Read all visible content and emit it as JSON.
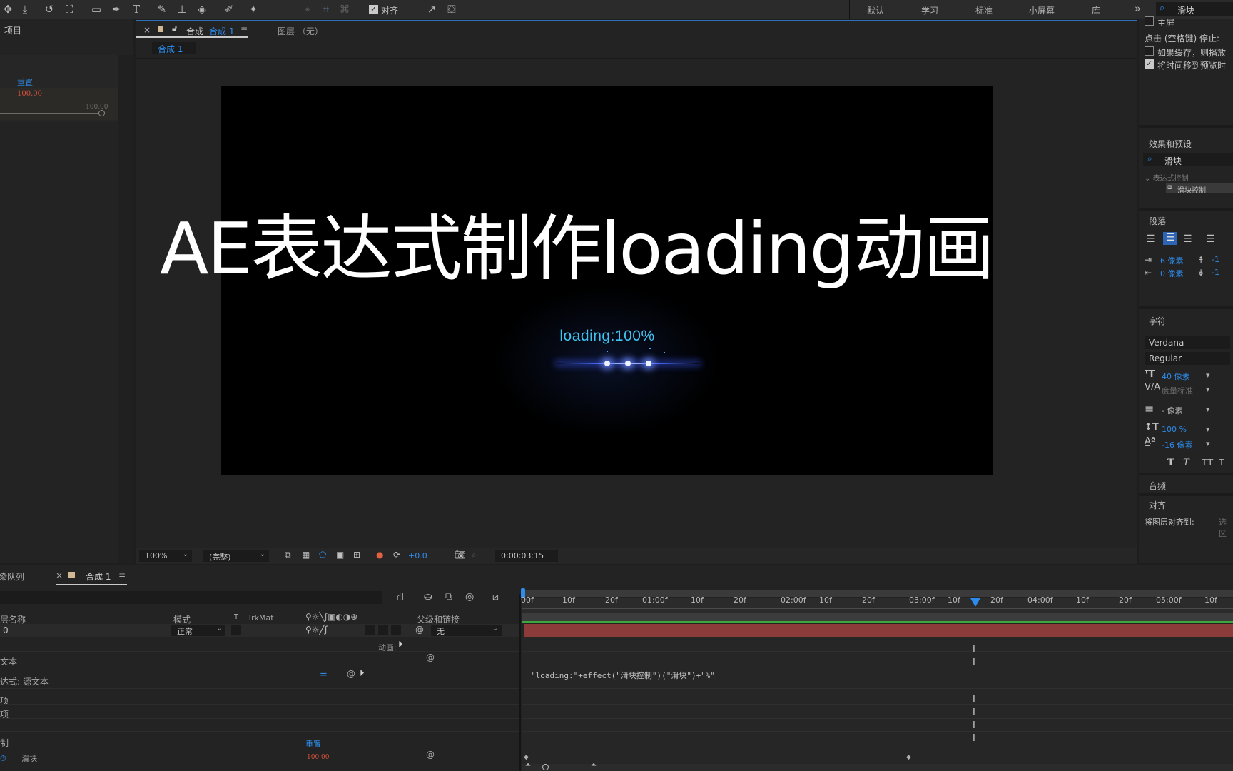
{
  "toolbar": {
    "align_label": "对齐",
    "workspaces": [
      "默认",
      "学习",
      "标准",
      "小屏幕",
      "库"
    ],
    "more": "»",
    "search_value": "滑块"
  },
  "project_panel": {
    "title": "项目",
    "reset_label": "重置",
    "value": "100.00",
    "slider_max": "100.00"
  },
  "comp_panel": {
    "close": "×",
    "tab_prefix": "合成",
    "tab_name": "合成 1",
    "layer_tab": "图层 （无）",
    "sub_tab": "合成 1",
    "zoom": "100%",
    "quality": "(完整)",
    "exposure": "+0.0",
    "timecode": "0:00:03:15"
  },
  "video": {
    "overlay_title": "AE表达式制作loading动画",
    "loading_text": "loading:100%"
  },
  "timeline": {
    "render_queue": "渲染队列",
    "close": "×",
    "tab": "合成 1",
    "col_layer_name": "图层名称",
    "col_mode": "模式",
    "col_t": "T",
    "col_trkmat": "TrkMat",
    "col_parent": "父级和链接",
    "layer_number": "0",
    "layer_mode": "正常",
    "parent_value": "无",
    "animate": "动画:",
    "source_text": "源文本",
    "expression_label": "表达式: 源文本",
    "option1": "选项",
    "option2": "选项",
    "effect_control": "控制",
    "slider_row": "滑块",
    "slider_reset": "重置",
    "slider_value": "100.00",
    "expression_code": "\"loading:\"+effect(\"滑块控制\")(\"滑块\")+\"%\"",
    "ruler": [
      "00f",
      "10f",
      "20f",
      "01:00f",
      "10f",
      "20f",
      "02:00f",
      "10f",
      "20f",
      "03:00f",
      "10f",
      "20f",
      "04:00f",
      "10f",
      "20f",
      "05:00f",
      "10f"
    ]
  },
  "right_panel": {
    "main_screen": "主屏",
    "stop_hint": "点击 (空格键) 停止:",
    "cache_option": "如果缓存，则播放",
    "move_time": "将时间移到预览时",
    "effects_title": "效果和预设",
    "effects_search": "滑块",
    "expr_control": "表达式控制",
    "slider_control": "滑块控制",
    "paragraph_title": "段落",
    "indent1": "6 像素",
    "indent2": "0 像素",
    "indent3": "-1",
    "indent4": "-1",
    "character_title": "字符",
    "font_name": "Verdana",
    "font_style": "Regular",
    "font_size": "40 像素",
    "kerning": "度量标准",
    "leading": "- 像素",
    "vscale": "100 %",
    "baseline": "-16 像素",
    "audio_title": "音频",
    "align_title": "对齐",
    "align_to": "将图层对齐到:",
    "align_sel": "选区"
  }
}
